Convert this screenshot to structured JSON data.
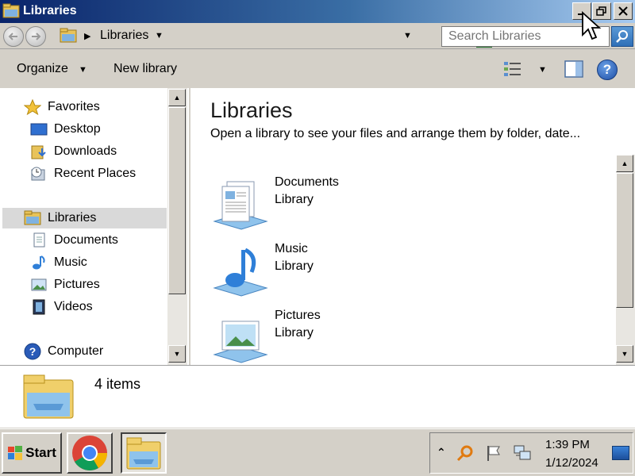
{
  "window": {
    "title": "Libraries",
    "buttons": {
      "minimize": "minimize",
      "restore": "restore",
      "close": "close"
    }
  },
  "address": {
    "path_label": "Libraries",
    "search_placeholder": "Search Libraries"
  },
  "commands": {
    "organize": "Organize",
    "new_library": "New library"
  },
  "navpane": {
    "favorites": "Favorites",
    "desktop": "Desktop",
    "downloads": "Downloads",
    "recent": "Recent Places",
    "libraries": "Libraries",
    "documents": "Documents",
    "music": "Music",
    "pictures": "Pictures",
    "videos": "Videos",
    "computer": "Computer"
  },
  "content": {
    "title": "Libraries",
    "subtitle": "Open a library to see your files and arrange them by folder, date...",
    "items": [
      {
        "name": "Documents",
        "type": "Library",
        "icon": "documents-library-icon"
      },
      {
        "name": "Music",
        "type": "Library",
        "icon": "music-library-icon"
      },
      {
        "name": "Pictures",
        "type": "Library",
        "icon": "pictures-library-icon"
      }
    ]
  },
  "details": {
    "count": "4 items"
  },
  "taskbar": {
    "start_label": "Start",
    "clock_time": "1:39 PM",
    "clock_date": "1/12/2024"
  },
  "colors": {
    "title_gradient_start": "#0a246a",
    "title_gradient_end": "#a6caf0",
    "chrome_face": "#d4d0c8",
    "selection": "#d9d9d9"
  }
}
